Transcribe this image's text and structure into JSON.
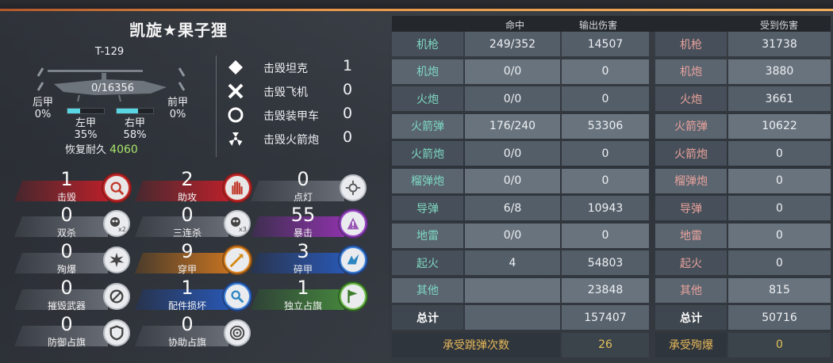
{
  "player": {
    "name": "凯旋★果子狸",
    "tank_id": "T-129",
    "hp": "0/16356",
    "armor": {
      "rear": {
        "label": "后甲",
        "value": "0%"
      },
      "front": {
        "label": "前甲",
        "value": "0%"
      },
      "left": {
        "label": "左甲",
        "value": "35%",
        "level": 0.35
      },
      "right": {
        "label": "右甲",
        "value": "58%",
        "level": 0.58
      }
    },
    "repair_label": "恢复耐久",
    "repair_value": "4060"
  },
  "kills": [
    {
      "icon": "diamond-icon",
      "label": "击毁坦克",
      "value": "1"
    },
    {
      "icon": "cross-icon",
      "label": "击毁飞机",
      "value": "0"
    },
    {
      "icon": "ring-icon",
      "label": "击毁装甲车",
      "value": "0"
    },
    {
      "icon": "radiation-icon",
      "label": "击毁火箭炮",
      "value": "0"
    }
  ],
  "stats": [
    {
      "value": "1",
      "label": "击毁",
      "color": "red",
      "icon": "kill-target-icon"
    },
    {
      "value": "2",
      "label": "助攻",
      "color": "red",
      "icon": "assist-hand-icon"
    },
    {
      "value": "0",
      "label": "点灯",
      "color": "gray",
      "icon": "spot-light-icon"
    },
    {
      "value": "0",
      "label": "双杀",
      "color": "gray",
      "icon": "skull-x2-icon"
    },
    {
      "value": "0",
      "label": "三连杀",
      "color": "gray",
      "icon": "skull-x3-icon"
    },
    {
      "value": "55",
      "label": "暴击",
      "color": "purple",
      "icon": "critical-icon"
    },
    {
      "value": "0",
      "label": "殉爆",
      "color": "gray",
      "icon": "explosion-icon"
    },
    {
      "value": "9",
      "label": "穿甲",
      "color": "orange",
      "icon": "penetration-icon"
    },
    {
      "value": "3",
      "label": "碎甲",
      "color": "blue",
      "icon": "shatter-icon"
    },
    {
      "value": "0",
      "label": "摧毁武器",
      "color": "gray",
      "icon": "destroy-weapon-icon"
    },
    {
      "value": "1",
      "label": "配件损坏",
      "color": "blue",
      "icon": "module-damage-icon"
    },
    {
      "value": "1",
      "label": "独立占旗",
      "color": "green",
      "icon": "flag-icon"
    },
    {
      "value": "0",
      "label": "防御占旗",
      "color": "gray",
      "icon": "shield-icon"
    },
    {
      "value": "0",
      "label": "协助占旗",
      "color": "gray",
      "icon": "target-rings-icon"
    }
  ],
  "table": {
    "headers": {
      "hits": "命中",
      "dealt": "输出伤害",
      "received": "受到伤害"
    },
    "rows": [
      {
        "weapon": "机枪",
        "hits": "249/352",
        "dealt": "14507",
        "weapon_r": "机枪",
        "received": "31738"
      },
      {
        "weapon": "机炮",
        "hits": "0/0",
        "dealt": "0",
        "weapon_r": "机炮",
        "received": "3880"
      },
      {
        "weapon": "火炮",
        "hits": "0/0",
        "dealt": "0",
        "weapon_r": "火炮",
        "received": "3661"
      },
      {
        "weapon": "火箭弹",
        "hits": "176/240",
        "dealt": "53306",
        "weapon_r": "火箭弹",
        "received": "10622"
      },
      {
        "weapon": "火箭炮",
        "hits": "0/0",
        "dealt": "0",
        "weapon_r": "火箭炮",
        "received": "0"
      },
      {
        "weapon": "榴弹炮",
        "hits": "0/0",
        "dealt": "0",
        "weapon_r": "榴弹炮",
        "received": "0"
      },
      {
        "weapon": "导弹",
        "hits": "6/8",
        "dealt": "10943",
        "weapon_r": "导弹",
        "received": "0"
      },
      {
        "weapon": "地雷",
        "hits": "0/0",
        "dealt": "0",
        "weapon_r": "地雷",
        "received": "0"
      },
      {
        "weapon": "起火",
        "hits": "4",
        "dealt": "54803",
        "weapon_r": "起火",
        "received": "0"
      },
      {
        "weapon": "其他",
        "hits": "",
        "dealt": "23848",
        "weapon_r": "其他",
        "received": "815"
      }
    ],
    "total": {
      "label": "总计",
      "dealt": "157407",
      "label_r": "总计",
      "received": "50716"
    },
    "extra": {
      "ricochet_label": "承受跳弹次数",
      "ricochet_value": "26",
      "ammo_label": "承受殉爆",
      "ammo_value": "0"
    }
  }
}
